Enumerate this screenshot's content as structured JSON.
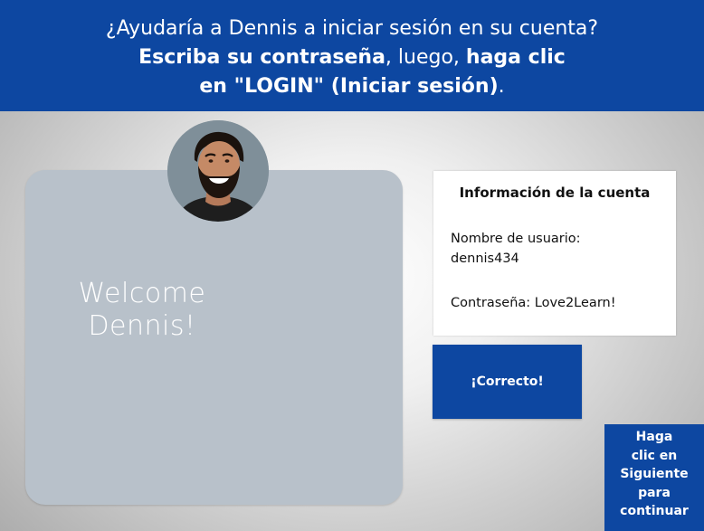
{
  "banner": {
    "line1": "¿Ayudaría a Dennis a iniciar sesión en su cuenta?",
    "line2_bold_a": "Escriba su contraseña",
    "line2_plain": ", luego, ",
    "line2_bold_b": "haga clic",
    "line3_bold": "en \"LOGIN\" (Iniciar sesión)",
    "line3_plain": "."
  },
  "welcome": {
    "text": "Welcome Dennis!"
  },
  "avatar": {
    "icon": "user-photo"
  },
  "account": {
    "title": "Información de la cuenta",
    "user_label": "Nombre de usuario:",
    "user_value": "dennis434",
    "password_line": "Contraseña: Love2Learn!"
  },
  "feedback": {
    "text": "¡Correcto!"
  },
  "next": {
    "line1": "Haga",
    "line2": "clic en",
    "line3": "Siguiente",
    "line4": "para",
    "line5": "continuar"
  },
  "colors": {
    "brand_blue": "#0d47a1",
    "card_gray": "#b8c1ca",
    "white": "#ffffff"
  }
}
